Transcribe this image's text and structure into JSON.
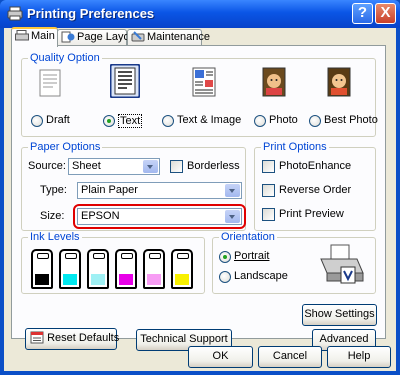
{
  "window": {
    "title": "Printing Preferences",
    "help_label": "?",
    "close_label": "X"
  },
  "tabs": [
    {
      "label": "Main",
      "active": true
    },
    {
      "label": "Page Layout",
      "active": false
    },
    {
      "label": "Maintenance",
      "active": false
    }
  ],
  "quality": {
    "title": "Quality Option",
    "options": [
      {
        "label": "Draft",
        "selected": false
      },
      {
        "label": "Text",
        "selected": true
      },
      {
        "label": "Text & Image",
        "selected": false
      },
      {
        "label": "Photo",
        "selected": false
      },
      {
        "label": "Best Photo",
        "selected": false
      }
    ]
  },
  "paper": {
    "title": "Paper Options",
    "source_label": "Source:",
    "source_value": "Sheet",
    "borderless_label": "Borderless",
    "type_label": "Type:",
    "type_value": "Plain Paper",
    "size_label": "Size:",
    "size_value": "EPSON",
    "highlight_color": "#e00000"
  },
  "print_options": {
    "title": "Print Options",
    "items": [
      {
        "label": "PhotoEnhance",
        "checked": false
      },
      {
        "label": "Reverse Order",
        "checked": false
      },
      {
        "label": "Print Preview",
        "checked": false
      }
    ]
  },
  "ink": {
    "title": "Ink Levels",
    "cartridges": [
      {
        "color": "#000000"
      },
      {
        "color": "#00e8ef"
      },
      {
        "color": "#9ff0f4"
      },
      {
        "color": "#e800e8"
      },
      {
        "color": "#f79cf4"
      },
      {
        "color": "#f8f000"
      }
    ]
  },
  "orientation": {
    "title": "Orientation",
    "portrait_label": "Portrait",
    "portrait_selected": true,
    "landscape_label": "Landscape",
    "landscape_selected": false
  },
  "buttons": {
    "show_settings": "Show Settings",
    "reset_defaults": "Reset Defaults",
    "technical_support": "Technical Support",
    "advanced": "Advanced",
    "ok": "OK",
    "cancel": "Cancel",
    "help": "Help"
  }
}
